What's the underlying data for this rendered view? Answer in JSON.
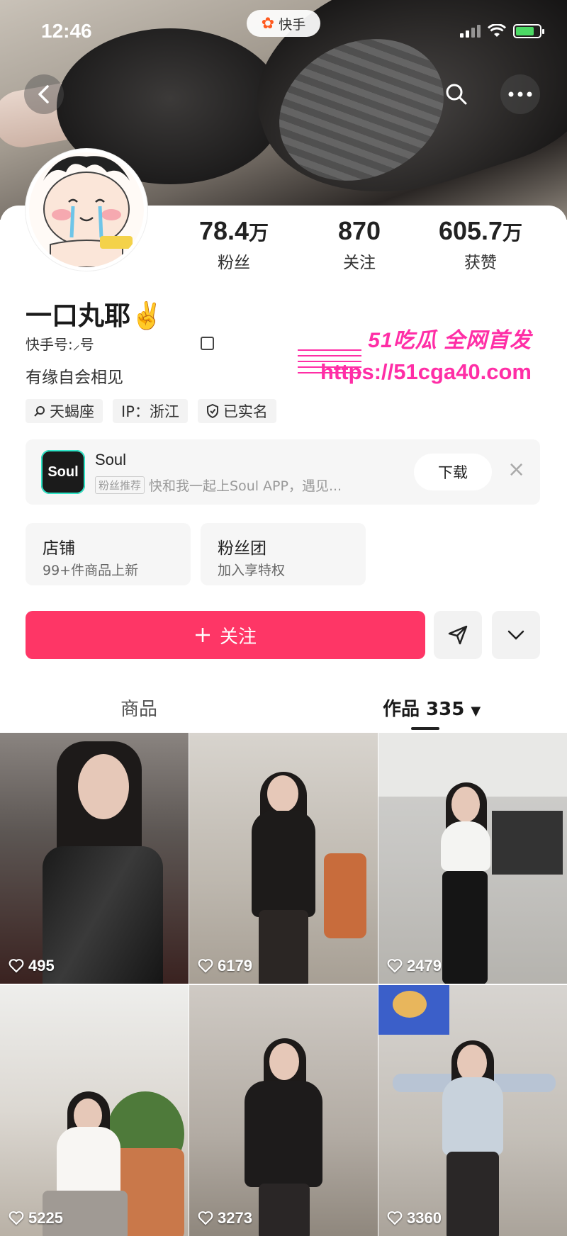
{
  "status_bar": {
    "time": "12:46",
    "app_name": "快手"
  },
  "profile": {
    "name": "一口丸耶✌️",
    "kuaishou_id_label": "快手号:",
    "kuaishou_id_value": "⸝号",
    "bio": "有缘自会相见",
    "stats": [
      {
        "value": "78.4",
        "unit": "万",
        "label": "粉丝"
      },
      {
        "value": "870",
        "unit": "",
        "label": "关注"
      },
      {
        "value": "605.7",
        "unit": "万",
        "label": "获赞"
      }
    ],
    "tags": [
      {
        "icon": "search-icon",
        "text": "天蝎座"
      },
      {
        "icon": "",
        "text": "IP：浙江"
      },
      {
        "icon": "shield-check-icon",
        "text": "已实名"
      }
    ]
  },
  "watermark": {
    "line1": "51吃瓜 全网首发",
    "line2": "https://51cga40.com"
  },
  "ad": {
    "logo_text": "Soul",
    "title": "Soul",
    "badge": "粉丝推荐",
    "subtitle": "快和我一起上Soul APP，遇见...",
    "button": "下载"
  },
  "shop": {
    "title": "店铺",
    "subtitle": "99+件商品上新"
  },
  "fan_group": {
    "title": "粉丝团",
    "subtitle": "加入享特权"
  },
  "follow_button": "关注",
  "tabs": [
    {
      "label": "商品"
    },
    {
      "label": "作品 335"
    }
  ],
  "posts": [
    {
      "likes": "495"
    },
    {
      "likes": "6179"
    },
    {
      "likes": "2479"
    },
    {
      "likes": "5225"
    },
    {
      "likes": "3273"
    },
    {
      "likes": "3360"
    }
  ],
  "colors": {
    "accent": "#fe3666",
    "watermark": "#ff2ea6",
    "battery": "#4cd964"
  }
}
